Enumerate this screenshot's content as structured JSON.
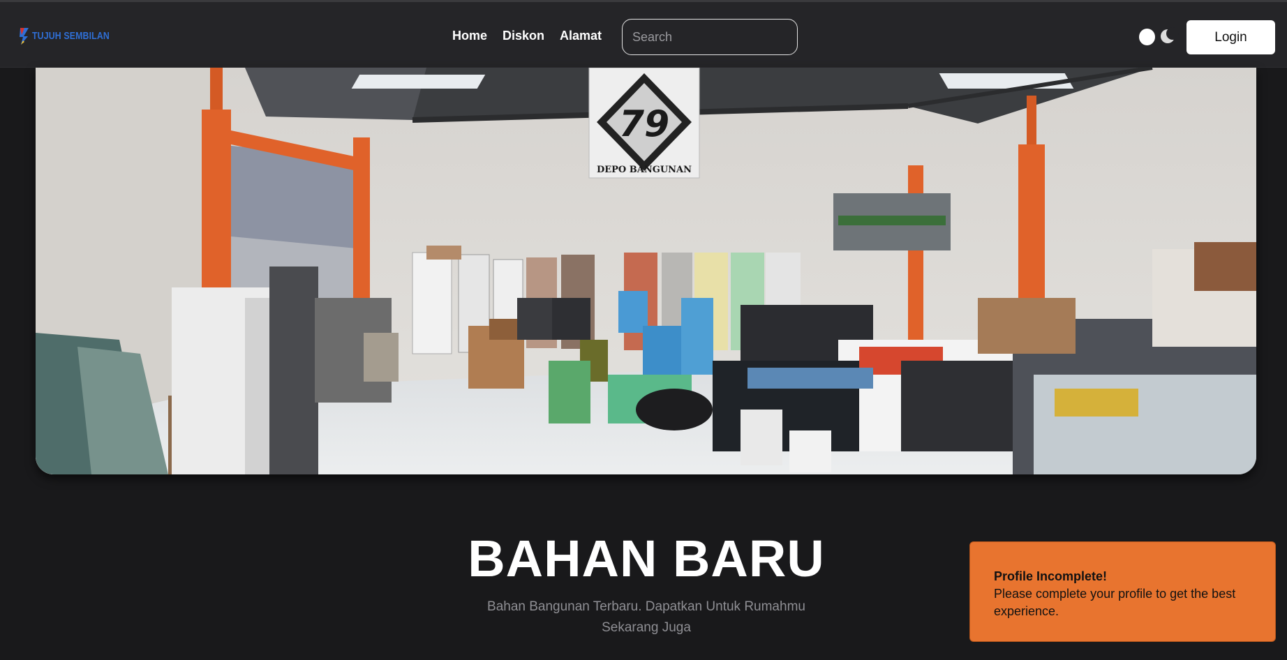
{
  "brand": {
    "name": "TUJUH SEMBILAN"
  },
  "nav": {
    "links": [
      {
        "label": "Home"
      },
      {
        "label": "Diskon"
      },
      {
        "label": "Alamat"
      }
    ]
  },
  "search": {
    "placeholder": "Search",
    "value": ""
  },
  "theme_toggle": {
    "icons": [
      "sun-icon",
      "moon-icon"
    ]
  },
  "auth": {
    "login_label": "Login"
  },
  "hero": {
    "image": "store-interior-photo",
    "sign_number": "79",
    "sign_caption": "DEPO BANGUNAN"
  },
  "section": {
    "title": "BAHAN BARU",
    "subtitle": "Bahan Bangunan Terbaru. Dapatkan Untuk Rumahmu Sekarang Juga"
  },
  "toast": {
    "title": "Profile Incomplete!",
    "message": "Please complete your profile to get the best experience."
  },
  "colors": {
    "background": "#19191b",
    "navbar": "#252528",
    "toast": "#e8742f",
    "brand": "#2f6fd6",
    "steel_orange": "#e0622a"
  }
}
